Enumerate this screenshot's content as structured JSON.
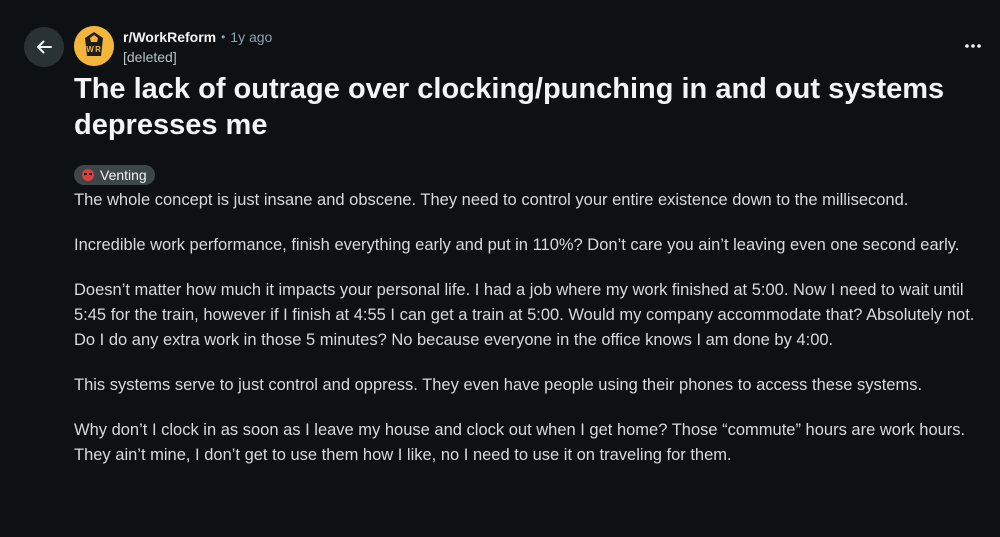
{
  "post": {
    "subreddit": "r/WorkReform",
    "separator": "•",
    "age": "1y ago",
    "author": "[deleted]",
    "title": "The lack of outrage over clocking/punching in and out systems depresses me",
    "flair": "Venting",
    "paragraphs": [
      "The whole concept is just insane and obscene. They need to control your entire existence down to the millisecond.",
      "Incredible work performance, finish everything early and put in 110%? Don’t care you ain’t leaving even one second early.",
      "Doesn’t matter how much it impacts your personal life. I had a job where my work finished at 5:00. Now I need to wait until 5:45 for the train, however if I finish at 4:55 I can get a train at 5:00. Would my company accommodate that? Absolutely not. Do I do any extra work in those 5 minutes? No because everyone in the office knows I am done by 4:00.",
      "This systems serve to just control and oppress. They even have people using their phones to access these systems.",
      "Why don’t I clock in as soon as I leave my house and clock out when I get home? Those “commute” hours are work hours. They ain’t mine, I don’t get to use them how I like, no I need to use it on traveling for them."
    ]
  },
  "avatar": {
    "letters": [
      "W",
      "R"
    ]
  },
  "icons": {
    "back": "arrow-left-icon",
    "more": "overflow-horizontal-icon",
    "flair_emoji": "angry-face-icon"
  },
  "colors": {
    "background": "#0e1113",
    "avatar_bg": "#f3b53a",
    "flair_bg": "#3e4649"
  }
}
